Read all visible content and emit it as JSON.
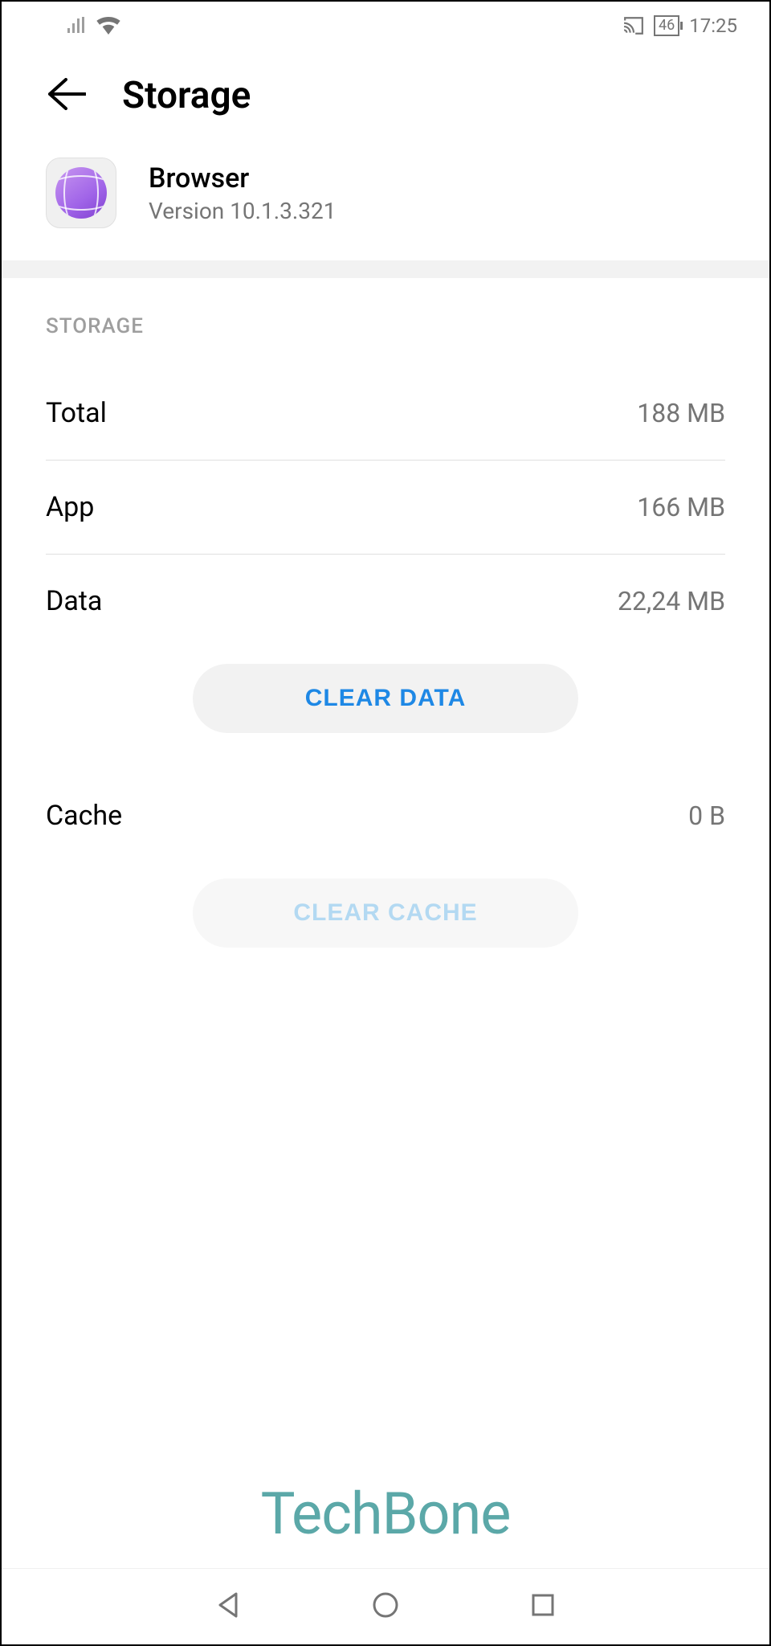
{
  "status": {
    "battery": "46",
    "time": "17:25"
  },
  "header": {
    "title": "Storage"
  },
  "app": {
    "name": "Browser",
    "version": "Version 10.1.3.321"
  },
  "section": {
    "heading": "STORAGE"
  },
  "rows": {
    "total_label": "Total",
    "total_value": "188 MB",
    "app_label": "App",
    "app_value": "166 MB",
    "data_label": "Data",
    "data_value": "22,24 MB",
    "cache_label": "Cache",
    "cache_value": "0 B"
  },
  "buttons": {
    "clear_data": "CLEAR DATA",
    "clear_cache": "CLEAR CACHE"
  },
  "watermark": "TechBone"
}
